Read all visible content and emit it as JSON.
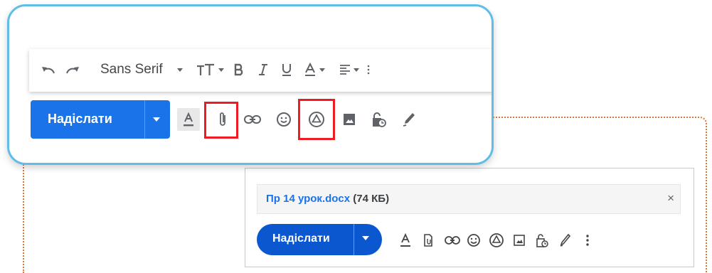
{
  "popup": {
    "format_bar": {
      "font": "Sans Serif"
    },
    "send_label": "Надіслати"
  },
  "compose": {
    "attachment": {
      "name": "Пр 14 урок.docx",
      "size": "(74 КБ)",
      "close": "×"
    },
    "send_label": "Надіслати"
  },
  "colors": {
    "accent_blue": "#1a73e8",
    "send_blue_dark": "#0b57d0",
    "highlight_red": "#ec1b24",
    "frame_blue": "#5fbde8",
    "dotted_orange": "#e07a3b"
  }
}
